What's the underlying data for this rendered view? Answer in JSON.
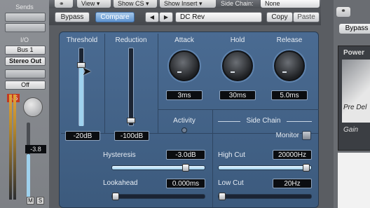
{
  "mixer": {
    "sends_label": "Sends",
    "io_label": "I/O",
    "input": "Bus 1",
    "output": "Stereo Out",
    "automation": "Off",
    "peak": "5.5",
    "fader_value": "-3.8",
    "mute": "M",
    "solo": "S"
  },
  "topbar": {
    "view": "View",
    "show_cs": "Show CS",
    "show_insert": "Show Insert",
    "side_chain_label": "Side Chain:",
    "side_chain_value": "None"
  },
  "toolbar": {
    "bypass": "Bypass",
    "compare": "Compare",
    "prev": "◀",
    "next": "▶",
    "preset": "DC Rev",
    "copy": "Copy",
    "paste": "Paste"
  },
  "gate": {
    "threshold": {
      "label": "Threshold",
      "value": "-20dB",
      "level": 0.7
    },
    "reduction": {
      "label": "Reduction",
      "value": "-100dB",
      "level": 0.08
    },
    "attack": {
      "label": "Attack",
      "value": "3ms"
    },
    "hold": {
      "label": "Hold",
      "value": "30ms"
    },
    "release": {
      "label": "Release",
      "value": "5.0ms"
    },
    "activity": "Activity",
    "side_chain": {
      "title": "Side Chain",
      "monitor": "Monitor",
      "high_cut_label": "High Cut",
      "high_cut_value": "20000Hz",
      "high_cut_level": 1.0,
      "low_cut_label": "Low Cut",
      "low_cut_value": "20Hz",
      "low_cut_level": 0.0
    },
    "hysteresis": {
      "label": "Hysteresis",
      "value": "-3.0dB",
      "level": 0.8
    },
    "lookahead": {
      "label": "Lookahead",
      "value": "0.000ms",
      "level": 0.0
    }
  },
  "right_panel": {
    "bypass": "Bypass",
    "title": "Power",
    "pre_delay": "Pre Del",
    "gain": "Gain"
  },
  "colors": {
    "panel": "#44648a",
    "accent": "#5e93cf",
    "lcd": "#0b0d10"
  }
}
